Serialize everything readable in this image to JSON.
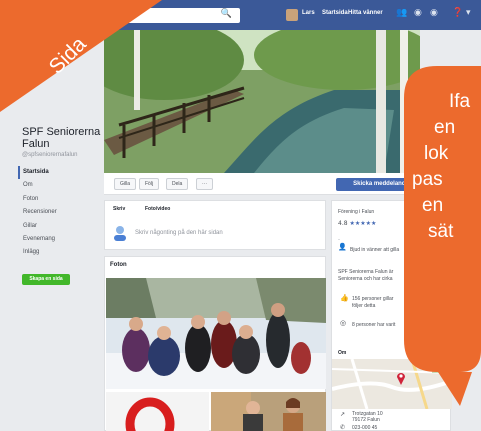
{
  "banner": {
    "label": "Sida"
  },
  "topbar": {
    "search_icon": "search-icon",
    "user_name": "Lars",
    "home_label": "Startsida",
    "friends_label": "Hitta vänner"
  },
  "page": {
    "name": "SPF Seniorerna Falun",
    "handle": "@spfseniorernafalun"
  },
  "nav": {
    "items": [
      "Startsida",
      "Om",
      "Foton",
      "Recensioner",
      "Gillar",
      "Evenemang",
      "Inlägg"
    ],
    "create_page": "Skapa en sida"
  },
  "actions": {
    "like": "Gilla",
    "follow": "Följ",
    "share": "Dela",
    "more": "···",
    "send_message": "Skicka meddelande"
  },
  "composer": {
    "write_tab": "Skriv",
    "photo_tab": "Foto/video",
    "placeholder": "Skriv någonting på den här sidan"
  },
  "photos": {
    "title": "Foton"
  },
  "sidebar": {
    "category": "Förening i Falun",
    "rating": "4.8",
    "stars": "★★★★★",
    "invite": "Bjud in vänner att gilla",
    "about_1": "SPF Seniorerna Falun är",
    "about_2": "Seniorerna och har cirka",
    "likes": "156 personer gillar",
    "likes_2": "följer detta",
    "follows": "8 personer har varit",
    "map_label": "Om",
    "address_1": "Trotzgatan 10",
    "address_2": "79172 Falun",
    "phone": "023-000 45"
  },
  "callout": {
    "lines": [
      "Ifa",
      "en",
      "lok",
      "pas",
      "en",
      "sät"
    ]
  },
  "colors": {
    "accent_orange": "#ec6a2d",
    "facebook_blue": "#3b5998",
    "button_blue": "#4267b2",
    "create_green": "#42b72a"
  }
}
